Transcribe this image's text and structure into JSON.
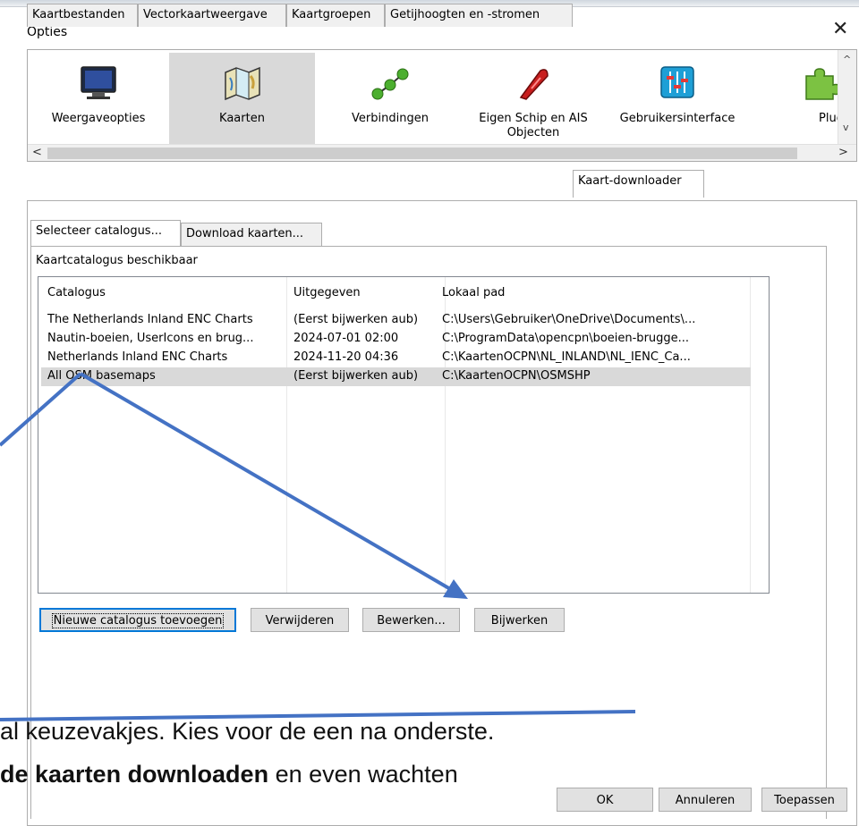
{
  "window": {
    "title": "Opties",
    "close_glyph": "✕"
  },
  "categories": [
    {
      "label": "Weergaveopties",
      "icon": "monitor-icon"
    },
    {
      "label": "Kaarten",
      "icon": "map-icon",
      "selected": true
    },
    {
      "label": "Verbindingen",
      "icon": "connections-icon"
    },
    {
      "label": "Eigen Schip en AIS Objecten",
      "icon": "ship-icon"
    },
    {
      "label": "Gebruikersinterface",
      "icon": "sliders-icon"
    },
    {
      "label": "Plugin",
      "icon": "puzzle-icon"
    }
  ],
  "tabs": [
    {
      "label": "Kaartbestanden"
    },
    {
      "label": "Vectorkaartweergave"
    },
    {
      "label": "Kaartgroepen"
    },
    {
      "label": "Getijhoogten en -stromen"
    },
    {
      "label": "Kaart-downloader",
      "active": true
    }
  ],
  "subtabs": [
    {
      "label": "Selecteer catalogus...",
      "active": true
    },
    {
      "label": "Download kaarten..."
    }
  ],
  "catalog": {
    "group_label": "Kaartcatalogus beschikbaar",
    "columns": [
      "Catalogus",
      "Uitgegeven",
      "Lokaal pad"
    ],
    "rows": [
      [
        "The Netherlands Inland ENC Charts",
        "(Eerst bijwerken aub)",
        "C:\\Users\\Gebruiker\\OneDrive\\Documents\\..."
      ],
      [
        "Nautin-boeien, UserIcons en brug...",
        "2024-07-01 02:00",
        "C:\\ProgramData\\opencpn\\boeien-brugge..."
      ],
      [
        "Netherlands Inland ENC Charts",
        "2024-11-20 04:36",
        "C:\\KaartenOCPN\\NL_INLAND\\NL_IENC_Ca..."
      ],
      [
        "All OSM basemaps",
        "(Eerst bijwerken aub)",
        "C:\\KaartenOCPN\\OSMSHP"
      ]
    ],
    "selected_row": 3
  },
  "buttons": {
    "add": "Nieuwe catalogus toevoegen",
    "remove": "Verwijderen",
    "edit": "Bewerken...",
    "update": "Bijwerken",
    "ok": "OK",
    "cancel": "Annuleren",
    "apply": "Toepassen"
  },
  "overlay": {
    "line1": "al keuzevakjes. Kies voor de een na onderste.",
    "line2_bold": "de kaarten downloaden",
    "line2_rest": " en even wachten",
    "arrow_color": "#4472c4"
  }
}
